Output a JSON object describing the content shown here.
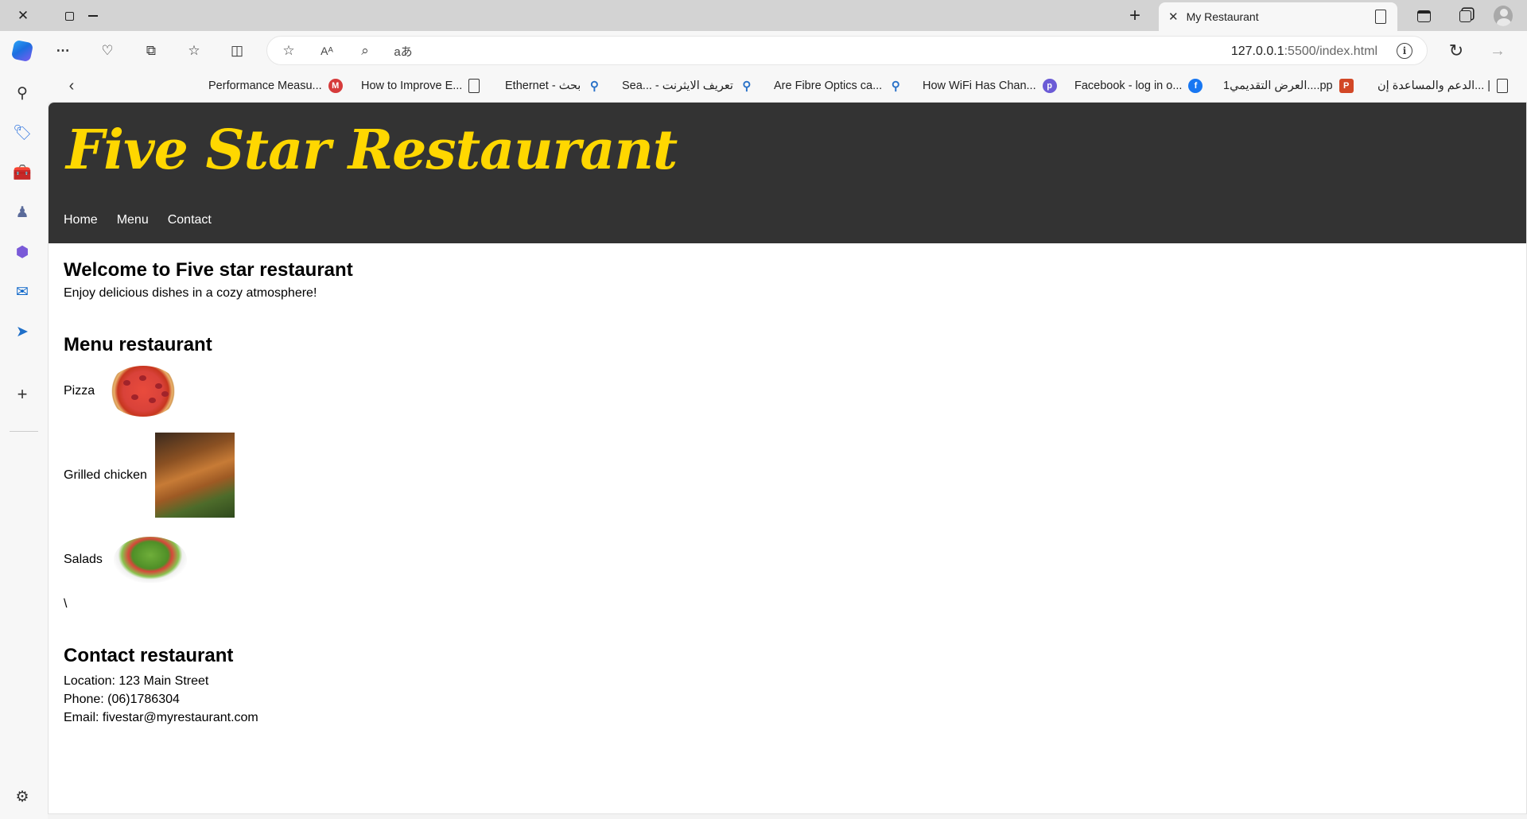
{
  "browser": {
    "tab_title": "My Restaurant",
    "url_host": "127.0.0.1",
    "url_rest": ":5500/index.html",
    "window_close": "✕",
    "new_tab": "+",
    "favorites": [
      {
        "label": "Performance Measu...",
        "icon": "m-icon",
        "icon_text": "M",
        "color": "#d63b3b"
      },
      {
        "label": "How to Improve E...",
        "icon": "document-icon"
      },
      {
        "label": "Ethernet - بحث",
        "icon": "search-icon"
      },
      {
        "label": "Sea... - تعريف الايثرنت",
        "icon": "search-icon"
      },
      {
        "label": "Are Fibre Optics ca...",
        "icon": "search-icon"
      },
      {
        "label": "How WiFi Has Chan...",
        "icon": "p-icon",
        "icon_text": "p",
        "color": "#6b5bd6"
      },
      {
        "label": "Facebook - log in o...",
        "icon": "facebook-icon",
        "icon_text": "f",
        "color": "#1877f2"
      },
      {
        "label": "العرض التقديمي1....pp",
        "icon": "powerpoint-icon",
        "icon_text": "P",
        "color": "#d24726"
      },
      {
        "label": "الدعم والمساعدة إن... |",
        "icon": "document-icon"
      }
    ]
  },
  "site": {
    "title": "Five Star Restaurant",
    "nav": [
      "Home",
      "Menu",
      "Contact"
    ],
    "welcome_heading": "Welcome to Five star restaurant",
    "welcome_text": "Enjoy delicious dishes in a cozy atmosphere!",
    "menu_heading": "Menu restaurant",
    "menu_items": [
      {
        "label": "Pizza",
        "image": "pizza-image"
      },
      {
        "label": "Grilled chicken",
        "image": "grilled-chicken-image"
      },
      {
        "label": "Salads",
        "image": "salad-image"
      }
    ],
    "stray_text": "\\",
    "contact_heading": "Contact restaurant",
    "contact_location": "Location: 123 Main Street",
    "contact_phone": "Phone: (06)1786304",
    "contact_email": "Email: fivestar@myrestaurant.com"
  },
  "colors": {
    "header_bg": "#333333",
    "title": "#ffd700"
  }
}
